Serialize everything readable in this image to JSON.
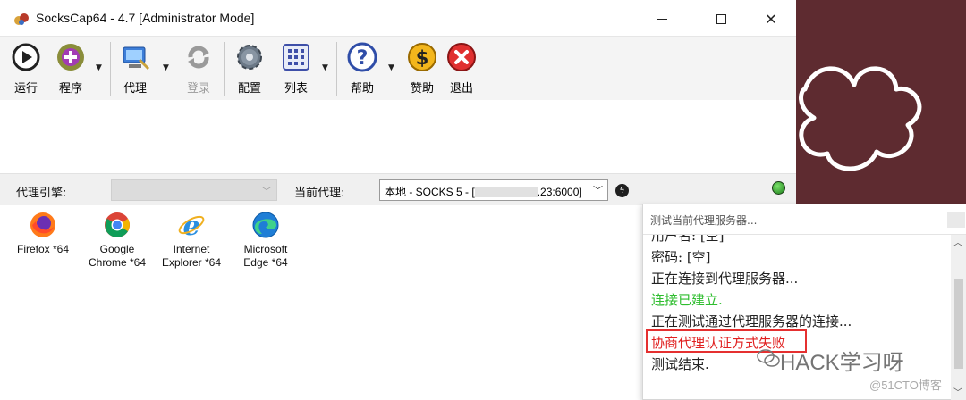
{
  "window": {
    "title": "SocksCap64 - 4.7 [Administrator Mode]",
    "controls": {
      "minimize": "—",
      "maximize": "☐",
      "close": "✕"
    }
  },
  "toolbar": {
    "items": [
      {
        "label": "运行",
        "icon": "run-icon"
      },
      {
        "label": "程序",
        "icon": "add-program-icon"
      },
      {
        "label": "代理",
        "icon": "proxy-icon"
      },
      {
        "label": "登录",
        "icon": "login-icon",
        "disabled": true
      },
      {
        "label": "配置",
        "icon": "settings-gear-icon"
      },
      {
        "label": "列表",
        "icon": "grid-list-icon"
      },
      {
        "label": "帮助",
        "icon": "help-icon"
      },
      {
        "label": "赞助",
        "icon": "dollar-icon"
      },
      {
        "label": "退出",
        "icon": "exit-icon"
      }
    ]
  },
  "proxy_bar": {
    "engine_label": "代理引擎:",
    "engine_value": "",
    "current_label": "当前代理:",
    "current_prefix": "本地 - SOCKS 5 - [",
    "current_suffix": ".23:6000]"
  },
  "programs": [
    {
      "name": "Firefox *64",
      "icon": "firefox-icon"
    },
    {
      "name": "Google\nChrome *64",
      "icon": "chrome-icon"
    },
    {
      "name": "Internet\nExplorer *64",
      "icon": "internet-explorer-icon"
    },
    {
      "name": "Microsoft\nEdge *64",
      "icon": "edge-icon"
    }
  ],
  "dialog": {
    "title": "测试当前代理服务器...",
    "lines": [
      {
        "text": "用户名: [空]",
        "color": "normal"
      },
      {
        "text": "密码: [空]",
        "color": "normal"
      },
      {
        "text": "正在连接到代理服务器...",
        "color": "normal"
      },
      {
        "text": "连接已建立.",
        "color": "green"
      },
      {
        "text": "正在测试通过代理服务器的连接...",
        "color": "normal"
      },
      {
        "text": "协商代理认证方式失败",
        "color": "red"
      },
      {
        "text": "测试结束.",
        "color": "normal"
      }
    ]
  },
  "watermark": {
    "main": "HACK学习呀",
    "sub": "@51CTO博客"
  },
  "colors": {
    "green": "#2ebd2e",
    "red": "#e02020",
    "background_photo": "#5e2b30"
  }
}
